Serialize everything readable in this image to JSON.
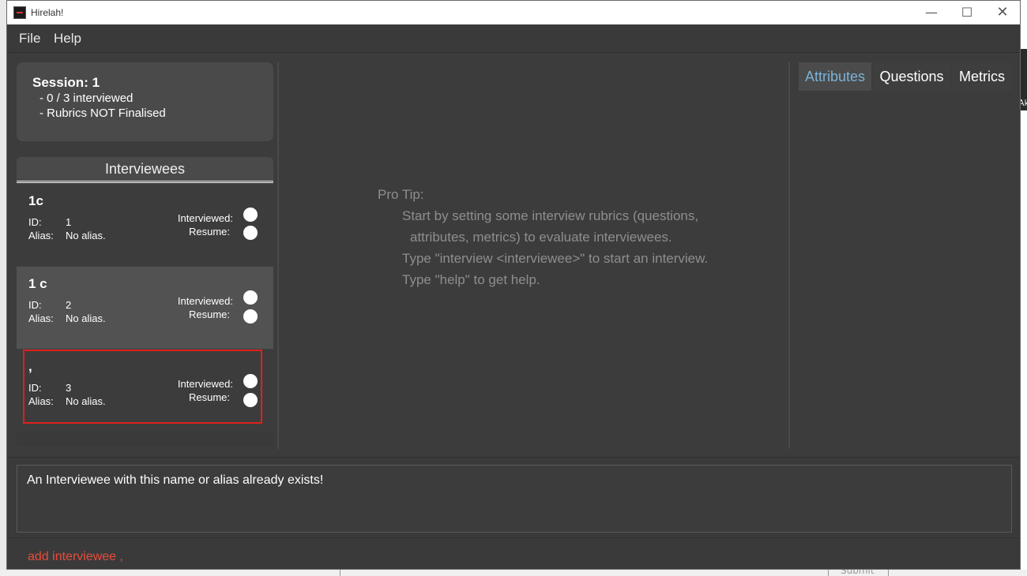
{
  "window": {
    "title": "Hirelah!",
    "controls": {
      "minimize": "—",
      "maximize": "☐",
      "close": "✕"
    }
  },
  "menu": {
    "file": "File",
    "help": "Help"
  },
  "session": {
    "title": "Session: 1",
    "interviewed": "- 0 / 3 interviewed",
    "rubrics": "- Rubrics NOT Finalised"
  },
  "interviewees": {
    "header": "Interviewees",
    "labels": {
      "id": "ID:",
      "alias": "Alias:",
      "interviewed": "Interviewed:",
      "resume": "Resume:"
    },
    "items": [
      {
        "name": "1c",
        "id": "1",
        "alias": "No alias."
      },
      {
        "name": "1 c",
        "id": "2",
        "alias": "No alias."
      },
      {
        "name": ",",
        "id": "3",
        "alias": "No alias."
      }
    ]
  },
  "tip": {
    "heading": "Pro Tip:",
    "line1": "Start by setting some interview rubrics (questions,",
    "line2": "attributes, metrics) to evaluate interviewees.",
    "line3": "Type \"interview <interviewee>\" to start an interview.",
    "line4": "Type \"help\" to get help."
  },
  "tabs": {
    "attributes": "Attributes",
    "questions": "Questions",
    "metrics": "Metrics"
  },
  "result": "An Interviewee with this name or alias already exists!",
  "command": {
    "value": "add interviewee ,"
  },
  "desktop": {
    "submit": "Submit",
    "thumb_label": "Ak"
  }
}
